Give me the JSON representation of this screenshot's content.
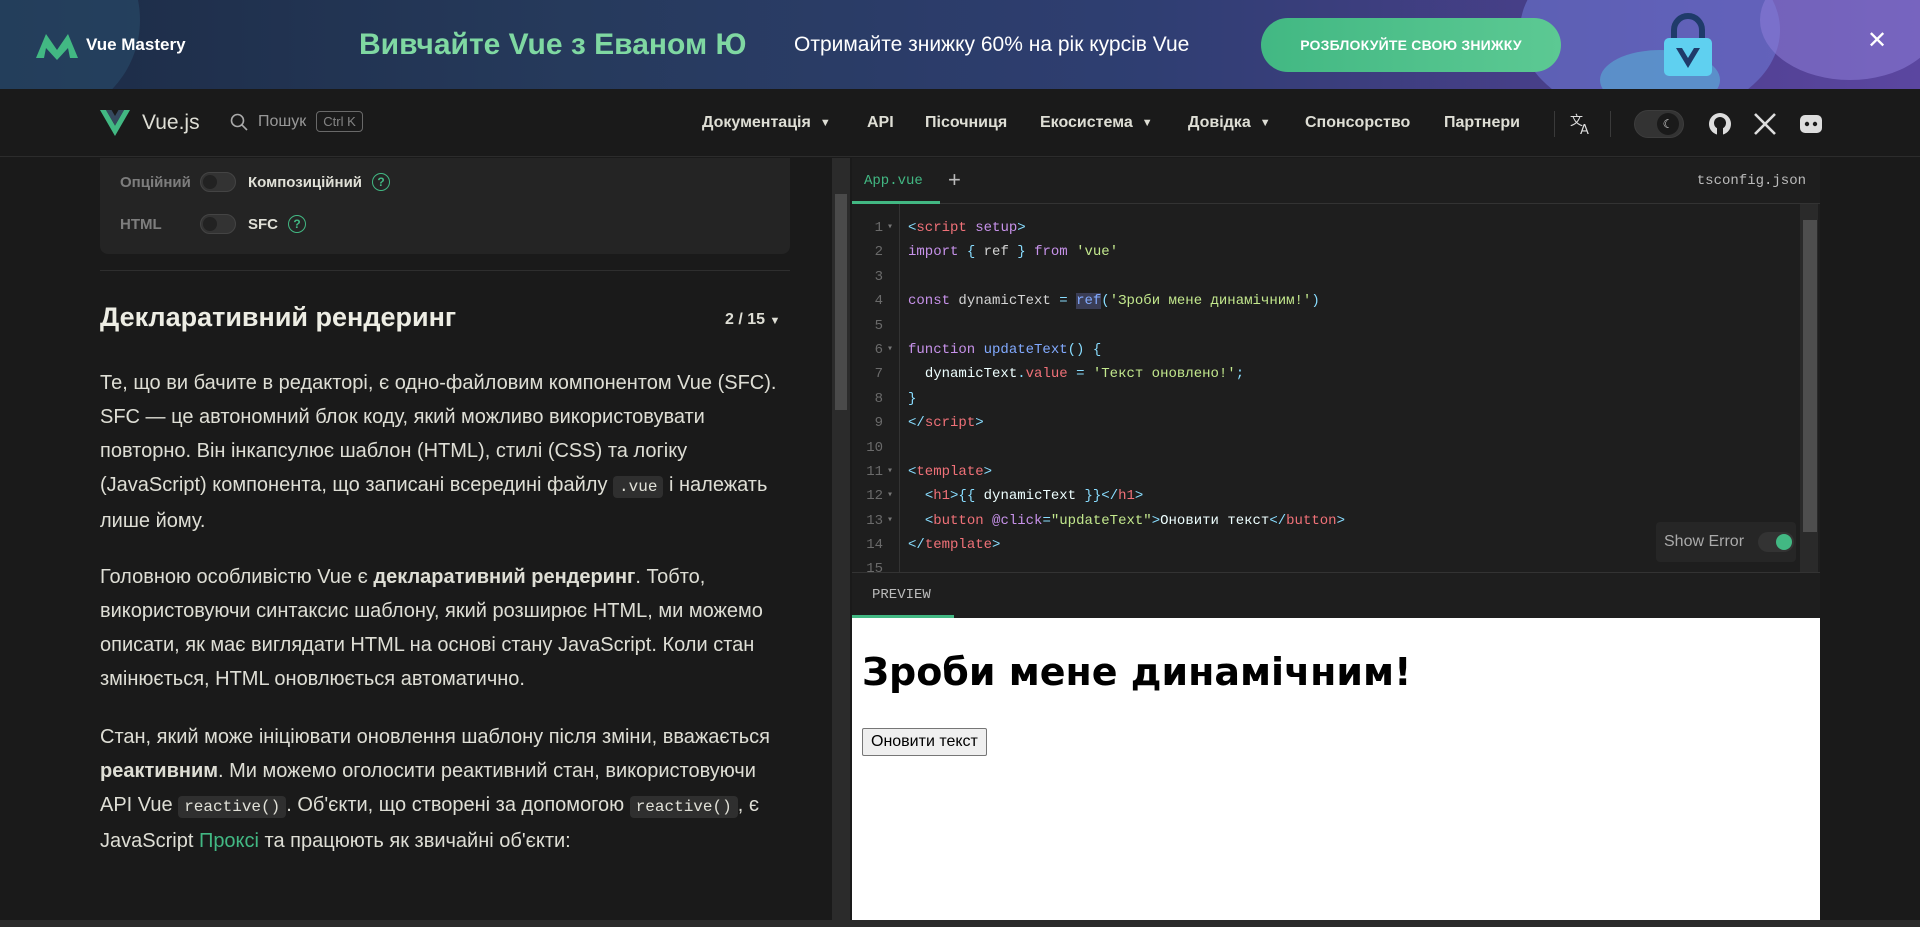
{
  "banner": {
    "brand": "Vue Mastery",
    "title": "Вивчайте Vue з Еваном Ю",
    "subtitle": "Отримайте знижку 60% на рік курсів Vue",
    "cta": "РОЗБЛОКУЙТЕ СВОЮ ЗНИЖКУ",
    "close": "✕"
  },
  "nav": {
    "logo": "Vue.js",
    "search_label": "Пошук",
    "search_kbd": "Ctrl K",
    "items": [
      {
        "label": "Документація",
        "dropdown": true
      },
      {
        "label": "API",
        "dropdown": false
      },
      {
        "label": "Пісочниця",
        "dropdown": false
      },
      {
        "label": "Екосистема",
        "dropdown": true
      },
      {
        "label": "Довідка",
        "dropdown": true
      },
      {
        "label": "Спонсорство",
        "dropdown": false
      },
      {
        "label": "Партнери",
        "dropdown": false
      }
    ],
    "icons": [
      "translate-icon",
      "moon-icon",
      "github-icon",
      "x-icon",
      "discord-icon"
    ]
  },
  "prefs": {
    "api_off": "Опційний",
    "api_on": "Композиційний",
    "format_off": "HTML",
    "format_on": "SFC",
    "help": "?"
  },
  "tutorial": {
    "title": "Декларативний рендеринг",
    "step": "2 / 15",
    "p1_a": "Те, що ви бачите в редакторі, є одно-файловим компонентом Vue (SFC). SFC — це автономний блок коду, який можливо використовувати повторно. Він інкапсулює шаблон (HTML), стилі (CSS) та логіку (JavaScript) компонента, що записані всередині файлу",
    "p1_code": ".vue",
    "p1_b": "і належать лише йому.",
    "p2_a": "Головною особливістю Vue є",
    "p2_bold": "декларативний рендеринг",
    "p2_b": ". Тобто, використовуючи синтаксис шаблону, який розширює HTML, ми можемо описати, як має виглядати HTML на основі стану JavaScript. Коли стан змінюється, HTML оновлюється автоматично.",
    "p3_a": "Стан, який може ініціювати оновлення шаблону після зміни, вважається",
    "p3_bold": "реактивним",
    "p3_b": ". Ми можемо оголосити реактивний стан, використовуючи API Vue",
    "p3_code1": "reactive()",
    "p3_c": ". Об'єкти, що створені за допомогою",
    "p3_code2": "reactive()",
    "p3_d": ", є JavaScript",
    "p3_link": "Проксі",
    "p3_e": "та працюють як звичайні об'єкти:"
  },
  "editor": {
    "active_tab": "App.vue",
    "add_tab": "+",
    "other_file": "tsconfig.json",
    "line_numbers": [
      "1",
      "2",
      "3",
      "4",
      "5",
      "6",
      "7",
      "8",
      "9",
      "10",
      "11",
      "12",
      "13",
      "14",
      "15"
    ],
    "show_error": "Show Error"
  },
  "preview": {
    "tab": "PREVIEW",
    "heading": "Зроби мене динамічним!",
    "button": "Оновити текст"
  },
  "colors": {
    "accent": "#42b883",
    "bg": "#1a1a1a"
  }
}
